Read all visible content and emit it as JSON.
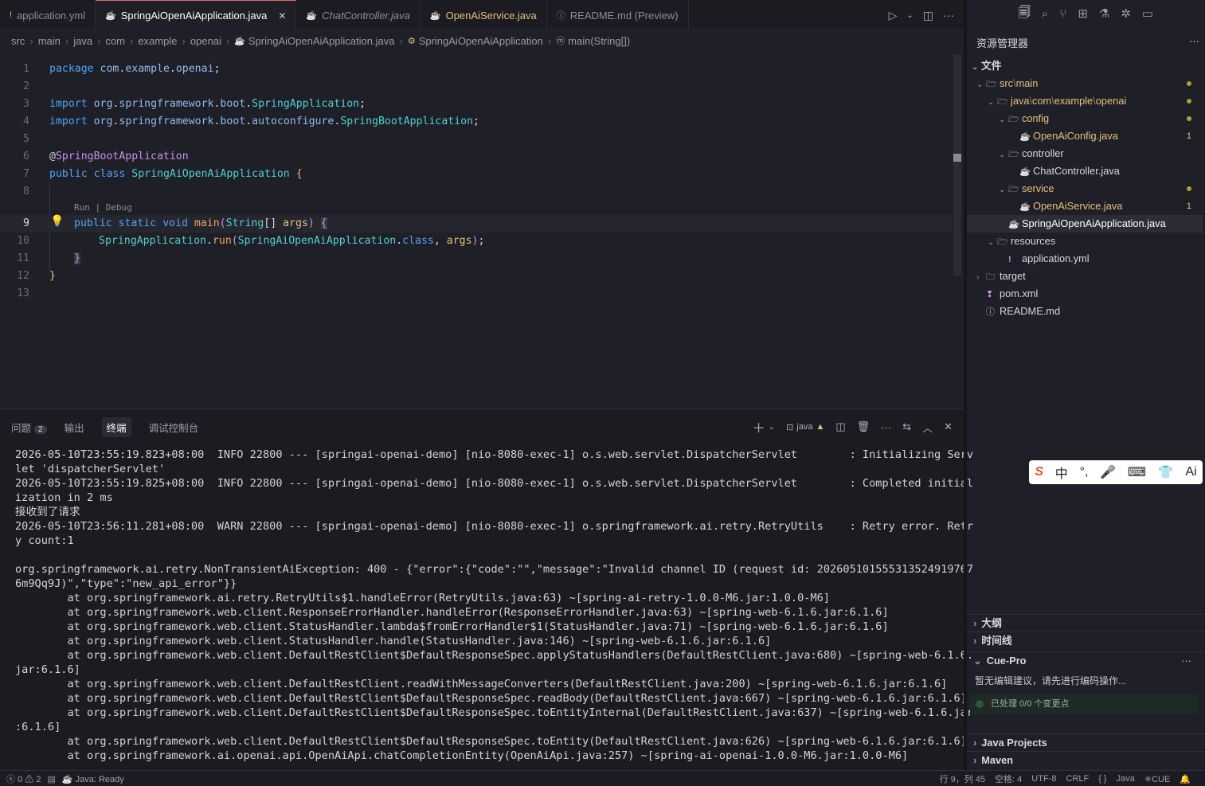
{
  "tabs": [
    {
      "icon": "!",
      "label": "application.yml",
      "active": false
    },
    {
      "icon": "☕",
      "label": "SpringAiOpenAiApplication.java",
      "active": true,
      "close": "✕"
    },
    {
      "icon": "☕",
      "label": "ChatController.java",
      "active": false
    },
    {
      "icon": "☕",
      "label": "OpenAiService.java",
      "active": false
    },
    {
      "icon": "ⓘ",
      "label": "README.md (Preview)",
      "active": false
    }
  ],
  "breadcrumb": [
    "src",
    "main",
    "java",
    "com",
    "example",
    "openai",
    "SpringAiOpenAiApplication.java",
    "SpringAiOpenAiApplication",
    "main(String[])"
  ],
  "editor": {
    "codelens": "Run | Debug",
    "line_numbers": [
      "1",
      "2",
      "3",
      "4",
      "5",
      "6",
      "7",
      "8",
      "9",
      "10",
      "11",
      "12",
      "13"
    ],
    "current_line": "9"
  },
  "panel": {
    "tabs": [
      {
        "label": "问题",
        "badge": "2"
      },
      {
        "label": "输出"
      },
      {
        "label": "终端",
        "active": true
      },
      {
        "label": "调试控制台"
      }
    ],
    "terminal_name": "java",
    "terminal_lines": [
      "2026-05-10T23:55:19.823+08:00  INFO 22800 --- [springai-openai-demo] [nio-8080-exec-1] o.s.web.servlet.DispatcherServlet        : Initializing Serv",
      "let 'dispatcherServlet'",
      "2026-05-10T23:55:19.825+08:00  INFO 22800 --- [springai-openai-demo] [nio-8080-exec-1] o.s.web.servlet.DispatcherServlet        : Completed initial",
      "ization in 2 ms",
      "接收到了请求",
      "2026-05-10T23:56:11.281+08:00  WARN 22800 --- [springai-openai-demo] [nio-8080-exec-1] o.springframework.ai.retry.RetryUtils    : Retry error. Retr",
      "y count:1",
      "",
      "org.springframework.ai.retry.NonTransientAiException: 400 - {\"error\":{\"code\":\"\",\"message\":\"Invalid channel ID (request id: 202605101555313524919767",
      "6m9Qq9J)\",\"type\":\"new_api_error\"}}",
      "        at org.springframework.ai.retry.RetryUtils$1.handleError(RetryUtils.java:63) ~[spring-ai-retry-1.0.0-M6.jar:1.0.0-M6]",
      "        at org.springframework.web.client.ResponseErrorHandler.handleError(ResponseErrorHandler.java:63) ~[spring-web-6.1.6.jar:6.1.6]",
      "        at org.springframework.web.client.StatusHandler.lambda$fromErrorHandler$1(StatusHandler.java:71) ~[spring-web-6.1.6.jar:6.1.6]",
      "        at org.springframework.web.client.StatusHandler.handle(StatusHandler.java:146) ~[spring-web-6.1.6.jar:6.1.6]",
      "        at org.springframework.web.client.DefaultRestClient$DefaultResponseSpec.applyStatusHandlers(DefaultRestClient.java:680) ~[spring-web-6.1.6.",
      "jar:6.1.6]",
      "        at org.springframework.web.client.DefaultRestClient.readWithMessageConverters(DefaultRestClient.java:200) ~[spring-web-6.1.6.jar:6.1.6]",
      "        at org.springframework.web.client.DefaultRestClient$DefaultResponseSpec.readBody(DefaultRestClient.java:667) ~[spring-web-6.1.6.jar:6.1.6]",
      "        at org.springframework.web.client.DefaultRestClient$DefaultResponseSpec.toEntityInternal(DefaultRestClient.java:637) ~[spring-web-6.1.6.jar",
      ":6.1.6]",
      "        at org.springframework.web.client.DefaultRestClient$DefaultResponseSpec.toEntity(DefaultRestClient.java:626) ~[spring-web-6.1.6.jar:6.1.6]",
      "        at org.springframework.ai.openai.api.OpenAiApi.chatCompletionEntity(OpenAiApi.java:257) ~[spring-ai-openai-1.0.0-M6.jar:1.0.0-M6]"
    ]
  },
  "explorer": {
    "title": "资源管理器",
    "more": "···",
    "section": "文件",
    "tree": {
      "src_main": "src",
      "main": "main",
      "java": "java",
      "com": "com",
      "example": "example",
      "openai": "openai",
      "config": "config",
      "config_file": "OpenAiConfig.java",
      "config_count": "1",
      "controller": "controller",
      "controller_file": "ChatController.java",
      "service": "service",
      "service_file": "OpenAiService.java",
      "service_count": "1",
      "app_file": "SpringAiOpenAiApplication.java",
      "resources": "resources",
      "yml": "application.yml",
      "target": "target",
      "pom": "pom.xml",
      "readme": "README.md"
    }
  },
  "sections": {
    "outline": "大纲",
    "timeline": "时间线",
    "cue_pro": "Cue-Pro",
    "java_projects": "Java Projects",
    "maven": "Maven"
  },
  "cue": {
    "message": "暂无编辑建议，请先进行编码操作...",
    "status": "已处理 0/0 个变更点"
  },
  "ime": {
    "logo": "S",
    "items": [
      "中",
      "°,",
      "🎤",
      "⌨",
      "👕",
      "Ai"
    ]
  },
  "statusbar": {
    "errors": "0",
    "warnings": "2",
    "java_status": "Java: Ready",
    "position": "行 9，列 45",
    "spaces": "空格: 4",
    "encoding": "UTF-8",
    "eol": "CRLF",
    "braces": "{ }",
    "language": "Java",
    "cue": "CUE"
  }
}
